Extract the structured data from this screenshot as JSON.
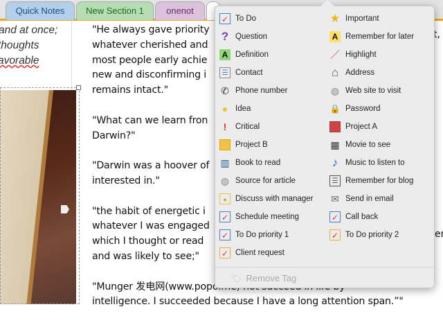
{
  "tabs": [
    {
      "label": "Quick Notes",
      "bg": "#b3cfea",
      "color": "#1a4f8a"
    },
    {
      "label": "New Section 1",
      "bg": "#b5dcb3",
      "color": "#1c6a1c"
    },
    {
      "label": "onenot",
      "bg": "#dcc1dc",
      "color": "#6a2a6a"
    }
  ],
  "left_text": [
    "and at once;",
    "thoughts",
    "avorable"
  ],
  "main_paragraphs": [
    [
      "\"He always gave priority",
      "whatever cherished and",
      "most people early achie",
      "new and disconfirming  i",
      "remains intact.\""
    ],
    [
      "\"What can we learn fron",
      "Darwin?\""
    ],
    [
      "\"Darwin was a hoover of",
      "interested in.\""
    ],
    [
      "\"the habit of energetic i",
      "whatever I was engaged",
      "which I thought  or read",
      "and was likely to see;\""
    ],
    [
      "\"Munger 发电网(www.popo.me) not succeed in life by",
      "intelligence. I succeeded because I have a long attention span.”\""
    ]
  ],
  "right_fragments": [
    "t,",
    "en"
  ],
  "tag_menu": {
    "left": [
      {
        "label": "To Do",
        "icon": "todo-checkbox-icon"
      },
      {
        "label": "Question",
        "icon": "question-icon"
      },
      {
        "label": "Definition",
        "icon": "definition-icon"
      },
      {
        "label": "Contact",
        "icon": "contact-card-icon"
      },
      {
        "label": "Phone number",
        "icon": "phone-icon"
      },
      {
        "label": "Idea",
        "icon": "lightbulb-icon"
      },
      {
        "label": "Critical",
        "icon": "exclamation-icon"
      },
      {
        "label": "Project B",
        "icon": "yellow-square-icon"
      },
      {
        "label": "Book to read",
        "icon": "book-icon"
      },
      {
        "label": "Source for article",
        "icon": "globe-link-icon"
      },
      {
        "label": "Discuss with manager",
        "icon": "person-icon"
      },
      {
        "label": "Schedule meeting",
        "icon": "arrow-checkbox-icon"
      },
      {
        "label": "To Do priority 1",
        "icon": "priority-1-icon"
      },
      {
        "label": "Client request",
        "icon": "client-request-icon"
      }
    ],
    "right": [
      {
        "label": "Important",
        "icon": "star-icon"
      },
      {
        "label": "Remember for later",
        "icon": "highlight-a-icon"
      },
      {
        "label": "Highlight",
        "icon": "marker-icon"
      },
      {
        "label": "Address",
        "icon": "house-icon"
      },
      {
        "label": "Web site to visit",
        "icon": "globe-link-icon"
      },
      {
        "label": "Password",
        "icon": "lock-icon"
      },
      {
        "label": "Project A",
        "icon": "red-square-icon"
      },
      {
        "label": "Movie to see",
        "icon": "film-icon"
      },
      {
        "label": "Music to listen to",
        "icon": "music-note-icon"
      },
      {
        "label": "Remember for blog",
        "icon": "speech-bubble-icon"
      },
      {
        "label": "Send in email",
        "icon": "email-icon"
      },
      {
        "label": "Call back",
        "icon": "arrow-checkbox-icon"
      },
      {
        "label": "To Do priority 2",
        "icon": "priority-2-icon"
      }
    ],
    "remove_label": "Remove Tag"
  }
}
